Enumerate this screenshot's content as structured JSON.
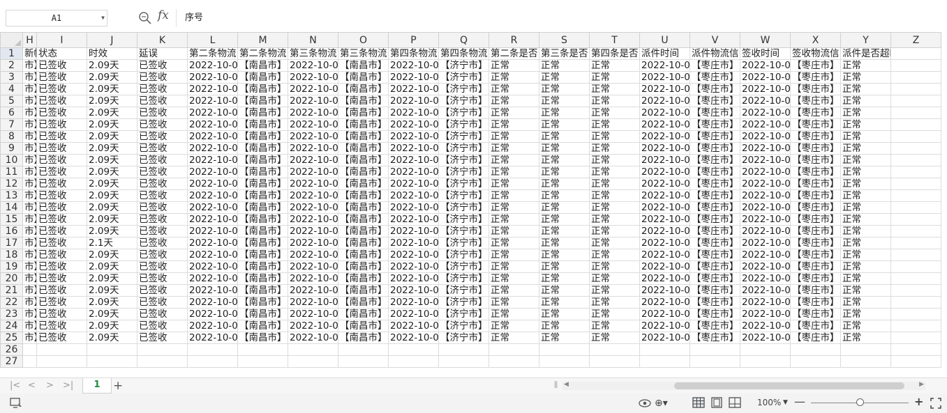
{
  "formula_bar": {
    "cell_ref": "A1",
    "fx_label": "fx",
    "formula_value": "序号"
  },
  "columns": [
    "H",
    "I",
    "J",
    "K",
    "L",
    "M",
    "N",
    "O",
    "P",
    "Q",
    "R",
    "S",
    "T",
    "U",
    "V",
    "W",
    "X",
    "Y",
    "Z"
  ],
  "header_row": [
    "新帐",
    "状态",
    "时效",
    "延误",
    "第二条物流",
    "第二条物流",
    "第三条物流",
    "第三条物流",
    "第四条物流",
    "第四条物流",
    "第二条是否",
    "第三条是否",
    "第四条是否",
    "派件时间",
    "派件物流信",
    "签收时间",
    "签收物流信",
    "派件是否超时",
    ""
  ],
  "rows": [
    [
      "市】",
      "已签收",
      "2.09天",
      "已签收",
      "2022-10-0",
      "【南昌市】",
      "2022-10-0",
      "【南昌市】",
      "2022-10-0",
      "【济宁市】",
      "正常",
      "正常",
      "正常",
      "2022-10-0",
      "【枣庄市】",
      "2022-10-0",
      "【枣庄市】",
      "正常",
      ""
    ],
    [
      "市】",
      "已签收",
      "2.09天",
      "已签收",
      "2022-10-0",
      "【南昌市】",
      "2022-10-0",
      "【南昌市】",
      "2022-10-0",
      "【济宁市】",
      "正常",
      "正常",
      "正常",
      "2022-10-0",
      "【枣庄市】",
      "2022-10-0",
      "【枣庄市】",
      "正常",
      ""
    ],
    [
      "市】",
      "已签收",
      "2.09天",
      "已签收",
      "2022-10-0",
      "【南昌市】",
      "2022-10-0",
      "【南昌市】",
      "2022-10-0",
      "【济宁市】",
      "正常",
      "正常",
      "正常",
      "2022-10-0",
      "【枣庄市】",
      "2022-10-0",
      "【枣庄市】",
      "正常",
      ""
    ],
    [
      "市】",
      "已签收",
      "2.09天",
      "已签收",
      "2022-10-0",
      "【南昌市】",
      "2022-10-0",
      "【南昌市】",
      "2022-10-0",
      "【济宁市】",
      "正常",
      "正常",
      "正常",
      "2022-10-0",
      "【枣庄市】",
      "2022-10-0",
      "【枣庄市】",
      "正常",
      ""
    ],
    [
      "市】",
      "已签收",
      "2.09天",
      "已签收",
      "2022-10-0",
      "【南昌市】",
      "2022-10-0",
      "【南昌市】",
      "2022-10-0",
      "【济宁市】",
      "正常",
      "正常",
      "正常",
      "2022-10-0",
      "【枣庄市】",
      "2022-10-0",
      "【枣庄市】",
      "正常",
      ""
    ],
    [
      "市】",
      "已签收",
      "2.09天",
      "已签收",
      "2022-10-0",
      "【南昌市】",
      "2022-10-0",
      "【南昌市】",
      "2022-10-0",
      "【济宁市】",
      "正常",
      "正常",
      "正常",
      "2022-10-0",
      "【枣庄市】",
      "2022-10-0",
      "【枣庄市】",
      "正常",
      ""
    ],
    [
      "市】",
      "已签收",
      "2.09天",
      "已签收",
      "2022-10-0",
      "【南昌市】",
      "2022-10-0",
      "【南昌市】",
      "2022-10-0",
      "【济宁市】",
      "正常",
      "正常",
      "正常",
      "2022-10-0",
      "【枣庄市】",
      "2022-10-0",
      "【枣庄市】",
      "正常",
      ""
    ],
    [
      "市】",
      "已签收",
      "2.09天",
      "已签收",
      "2022-10-0",
      "【南昌市】",
      "2022-10-0",
      "【南昌市】",
      "2022-10-0",
      "【济宁市】",
      "正常",
      "正常",
      "正常",
      "2022-10-0",
      "【枣庄市】",
      "2022-10-0",
      "【枣庄市】",
      "正常",
      ""
    ],
    [
      "市】",
      "已签收",
      "2.09天",
      "已签收",
      "2022-10-0",
      "【南昌市】",
      "2022-10-0",
      "【南昌市】",
      "2022-10-0",
      "【济宁市】",
      "正常",
      "正常",
      "正常",
      "2022-10-0",
      "【枣庄市】",
      "2022-10-0",
      "【枣庄市】",
      "正常",
      ""
    ],
    [
      "市】",
      "已签收",
      "2.09天",
      "已签收",
      "2022-10-0",
      "【南昌市】",
      "2022-10-0",
      "【南昌市】",
      "2022-10-0",
      "【济宁市】",
      "正常",
      "正常",
      "正常",
      "2022-10-0",
      "【枣庄市】",
      "2022-10-0",
      "【枣庄市】",
      "正常",
      ""
    ],
    [
      "市】",
      "已签收",
      "2.09天",
      "已签收",
      "2022-10-0",
      "【南昌市】",
      "2022-10-0",
      "【南昌市】",
      "2022-10-0",
      "【济宁市】",
      "正常",
      "正常",
      "正常",
      "2022-10-0",
      "【枣庄市】",
      "2022-10-0",
      "【枣庄市】",
      "正常",
      ""
    ],
    [
      "市】",
      "已签收",
      "2.09天",
      "已签收",
      "2022-10-0",
      "【南昌市】",
      "2022-10-0",
      "【南昌市】",
      "2022-10-0",
      "【济宁市】",
      "正常",
      "正常",
      "正常",
      "2022-10-0",
      "【枣庄市】",
      "2022-10-0",
      "【枣庄市】",
      "正常",
      ""
    ],
    [
      "市】",
      "已签收",
      "2.09天",
      "已签收",
      "2022-10-0",
      "【南昌市】",
      "2022-10-0",
      "【南昌市】",
      "2022-10-0",
      "【济宁市】",
      "正常",
      "正常",
      "正常",
      "2022-10-0",
      "【枣庄市】",
      "2022-10-0",
      "【枣庄市】",
      "正常",
      ""
    ],
    [
      "市】",
      "已签收",
      "2.09天",
      "已签收",
      "2022-10-0",
      "【南昌市】",
      "2022-10-0",
      "【南昌市】",
      "2022-10-0",
      "【济宁市】",
      "正常",
      "正常",
      "正常",
      "2022-10-0",
      "【枣庄市】",
      "2022-10-0",
      "【枣庄市】",
      "正常",
      ""
    ],
    [
      "市】",
      "已签收",
      "2.09天",
      "已签收",
      "2022-10-0",
      "【南昌市】",
      "2022-10-0",
      "【南昌市】",
      "2022-10-0",
      "【济宁市】",
      "正常",
      "正常",
      "正常",
      "2022-10-0",
      "【枣庄市】",
      "2022-10-0",
      "【枣庄市】",
      "正常",
      ""
    ],
    [
      "市】",
      "已签收",
      "2.1天",
      "已签收",
      "2022-10-0",
      "【南昌市】",
      "2022-10-0",
      "【南昌市】",
      "2022-10-0",
      "【济宁市】",
      "正常",
      "正常",
      "正常",
      "2022-10-0",
      "【枣庄市】",
      "2022-10-0",
      "【枣庄市】",
      "正常",
      ""
    ],
    [
      "市】",
      "已签收",
      "2.09天",
      "已签收",
      "2022-10-0",
      "【南昌市】",
      "2022-10-0",
      "【南昌市】",
      "2022-10-0",
      "【济宁市】",
      "正常",
      "正常",
      "正常",
      "2022-10-0",
      "【枣庄市】",
      "2022-10-0",
      "【枣庄市】",
      "正常",
      ""
    ],
    [
      "市】",
      "已签收",
      "2.09天",
      "已签收",
      "2022-10-0",
      "【南昌市】",
      "2022-10-0",
      "【南昌市】",
      "2022-10-0",
      "【济宁市】",
      "正常",
      "正常",
      "正常",
      "2022-10-0",
      "【枣庄市】",
      "2022-10-0",
      "【枣庄市】",
      "正常",
      ""
    ],
    [
      "市】",
      "已签收",
      "2.09天",
      "已签收",
      "2022-10-0",
      "【南昌市】",
      "2022-10-0",
      "【南昌市】",
      "2022-10-0",
      "【济宁市】",
      "正常",
      "正常",
      "正常",
      "2022-10-0",
      "【枣庄市】",
      "2022-10-0",
      "【枣庄市】",
      "正常",
      ""
    ],
    [
      "市】",
      "已签收",
      "2.09天",
      "已签收",
      "2022-10-0",
      "【南昌市】",
      "2022-10-0",
      "【南昌市】",
      "2022-10-0",
      "【济宁市】",
      "正常",
      "正常",
      "正常",
      "2022-10-0",
      "【枣庄市】",
      "2022-10-0",
      "【枣庄市】",
      "正常",
      ""
    ],
    [
      "市】",
      "已签收",
      "2.09天",
      "已签收",
      "2022-10-0",
      "【南昌市】",
      "2022-10-0",
      "【南昌市】",
      "2022-10-0",
      "【济宁市】",
      "正常",
      "正常",
      "正常",
      "2022-10-0",
      "【枣庄市】",
      "2022-10-0",
      "【枣庄市】",
      "正常",
      ""
    ],
    [
      "市】",
      "已签收",
      "2.09天",
      "已签收",
      "2022-10-0",
      "【南昌市】",
      "2022-10-0",
      "【南昌市】",
      "2022-10-0",
      "【济宁市】",
      "正常",
      "正常",
      "正常",
      "2022-10-0",
      "【枣庄市】",
      "2022-10-0",
      "【枣庄市】",
      "正常",
      ""
    ],
    [
      "市】",
      "已签收",
      "2.09天",
      "已签收",
      "2022-10-0",
      "【南昌市】",
      "2022-10-0",
      "【南昌市】",
      "2022-10-0",
      "【济宁市】",
      "正常",
      "正常",
      "正常",
      "2022-10-0",
      "【枣庄市】",
      "2022-10-0",
      "【枣庄市】",
      "正常",
      ""
    ],
    [
      "市】",
      "已签收",
      "2.09天",
      "已签收",
      "2022-10-0",
      "【南昌市】",
      "2022-10-0",
      "【南昌市】",
      "2022-10-0",
      "【济宁市】",
      "正常",
      "正常",
      "正常",
      "2022-10-0",
      "【枣庄市】",
      "2022-10-0",
      "【枣庄市】",
      "正常",
      ""
    ]
  ],
  "row_numbers": [
    "1",
    "2",
    "3",
    "4",
    "5",
    "6",
    "7",
    "8",
    "9",
    "10",
    "11",
    "12",
    "13",
    "14",
    "15",
    "16",
    "17",
    "18",
    "19",
    "20",
    "21",
    "22",
    "23",
    "24",
    "25",
    "26",
    "27"
  ],
  "sheet_tabs": {
    "active_tab": "1",
    "add_tab_label": "+"
  },
  "statusbar": {
    "zoom_level": "100%",
    "zoom_level_fraction": 0.5
  },
  "colors": {
    "active_tab_text": "#1e8b3c",
    "selected_header": "#e3e7ef"
  }
}
